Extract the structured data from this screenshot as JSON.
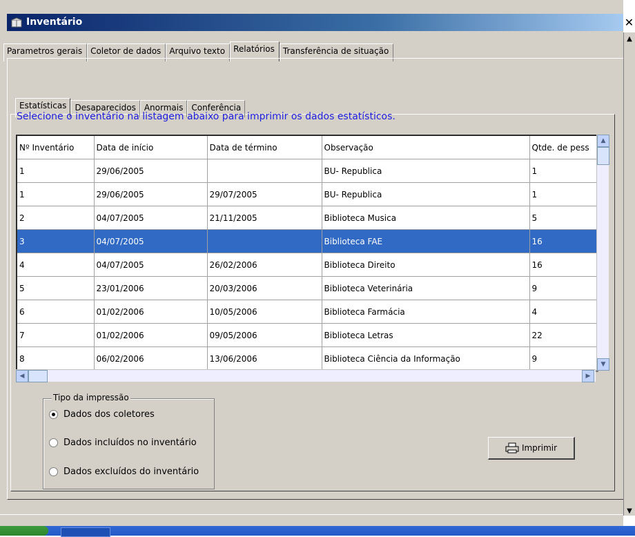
{
  "window": {
    "title": "Inventário",
    "close_label": "✕"
  },
  "main_tabs": [
    {
      "label": "Parametros gerais"
    },
    {
      "label": "Coletor de dados"
    },
    {
      "label": "Arquivo texto"
    },
    {
      "label": "Relatórios"
    },
    {
      "label": "Transferência de situação"
    }
  ],
  "sub_tabs": [
    {
      "label": "Estatísticas"
    },
    {
      "label": "Desaparecidos"
    },
    {
      "label": "Anormais"
    },
    {
      "label": "Conferência"
    }
  ],
  "instruction": "Selecione o inventário na listagem abaixo para imprimir os dados estatísticos.",
  "table": {
    "headers": [
      "Nº Inventário",
      "Data de início",
      "Data de término",
      "Observação",
      "Qtde. de pess"
    ],
    "rows": [
      [
        "1",
        "29/06/2005",
        "",
        "BU- Republica",
        "1"
      ],
      [
        "1",
        "29/06/2005",
        "29/07/2005",
        "BU- Republica",
        "1"
      ],
      [
        "2",
        "04/07/2005",
        "21/11/2005",
        "Biblioteca Musica",
        "5"
      ],
      [
        "3",
        "04/07/2005",
        "",
        "Biblioteca FAE",
        "16"
      ],
      [
        "4",
        "04/07/2005",
        "26/02/2006",
        "Biblioteca Direito",
        "16"
      ],
      [
        "5",
        "23/01/2006",
        "20/03/2006",
        "Biblioteca Veterinária",
        "9"
      ],
      [
        "6",
        "01/02/2006",
        "10/05/2006",
        "Biblioteca Farmácia",
        "4"
      ],
      [
        "7",
        "01/02/2006",
        "09/05/2006",
        "Biblioteca Letras",
        "22"
      ],
      [
        "8",
        "06/02/2006",
        "13/06/2006",
        "Biblioteca Ciência da Informação",
        "9"
      ]
    ]
  },
  "print_type": {
    "legend": "Tipo da impressão",
    "options": [
      {
        "label": "Dados dos coletores"
      },
      {
        "label": "Dados incluídos no inventário"
      },
      {
        "label": "Dados excluídos do inventário"
      }
    ]
  },
  "print_button": {
    "label": "Imprimir"
  },
  "colors": {
    "selection": "#316ac5",
    "instruction_text": "#2020e0",
    "title_bar": "#0a246a"
  },
  "icons": {
    "window_icon": "box-icon",
    "print_icon": "printer-icon"
  }
}
